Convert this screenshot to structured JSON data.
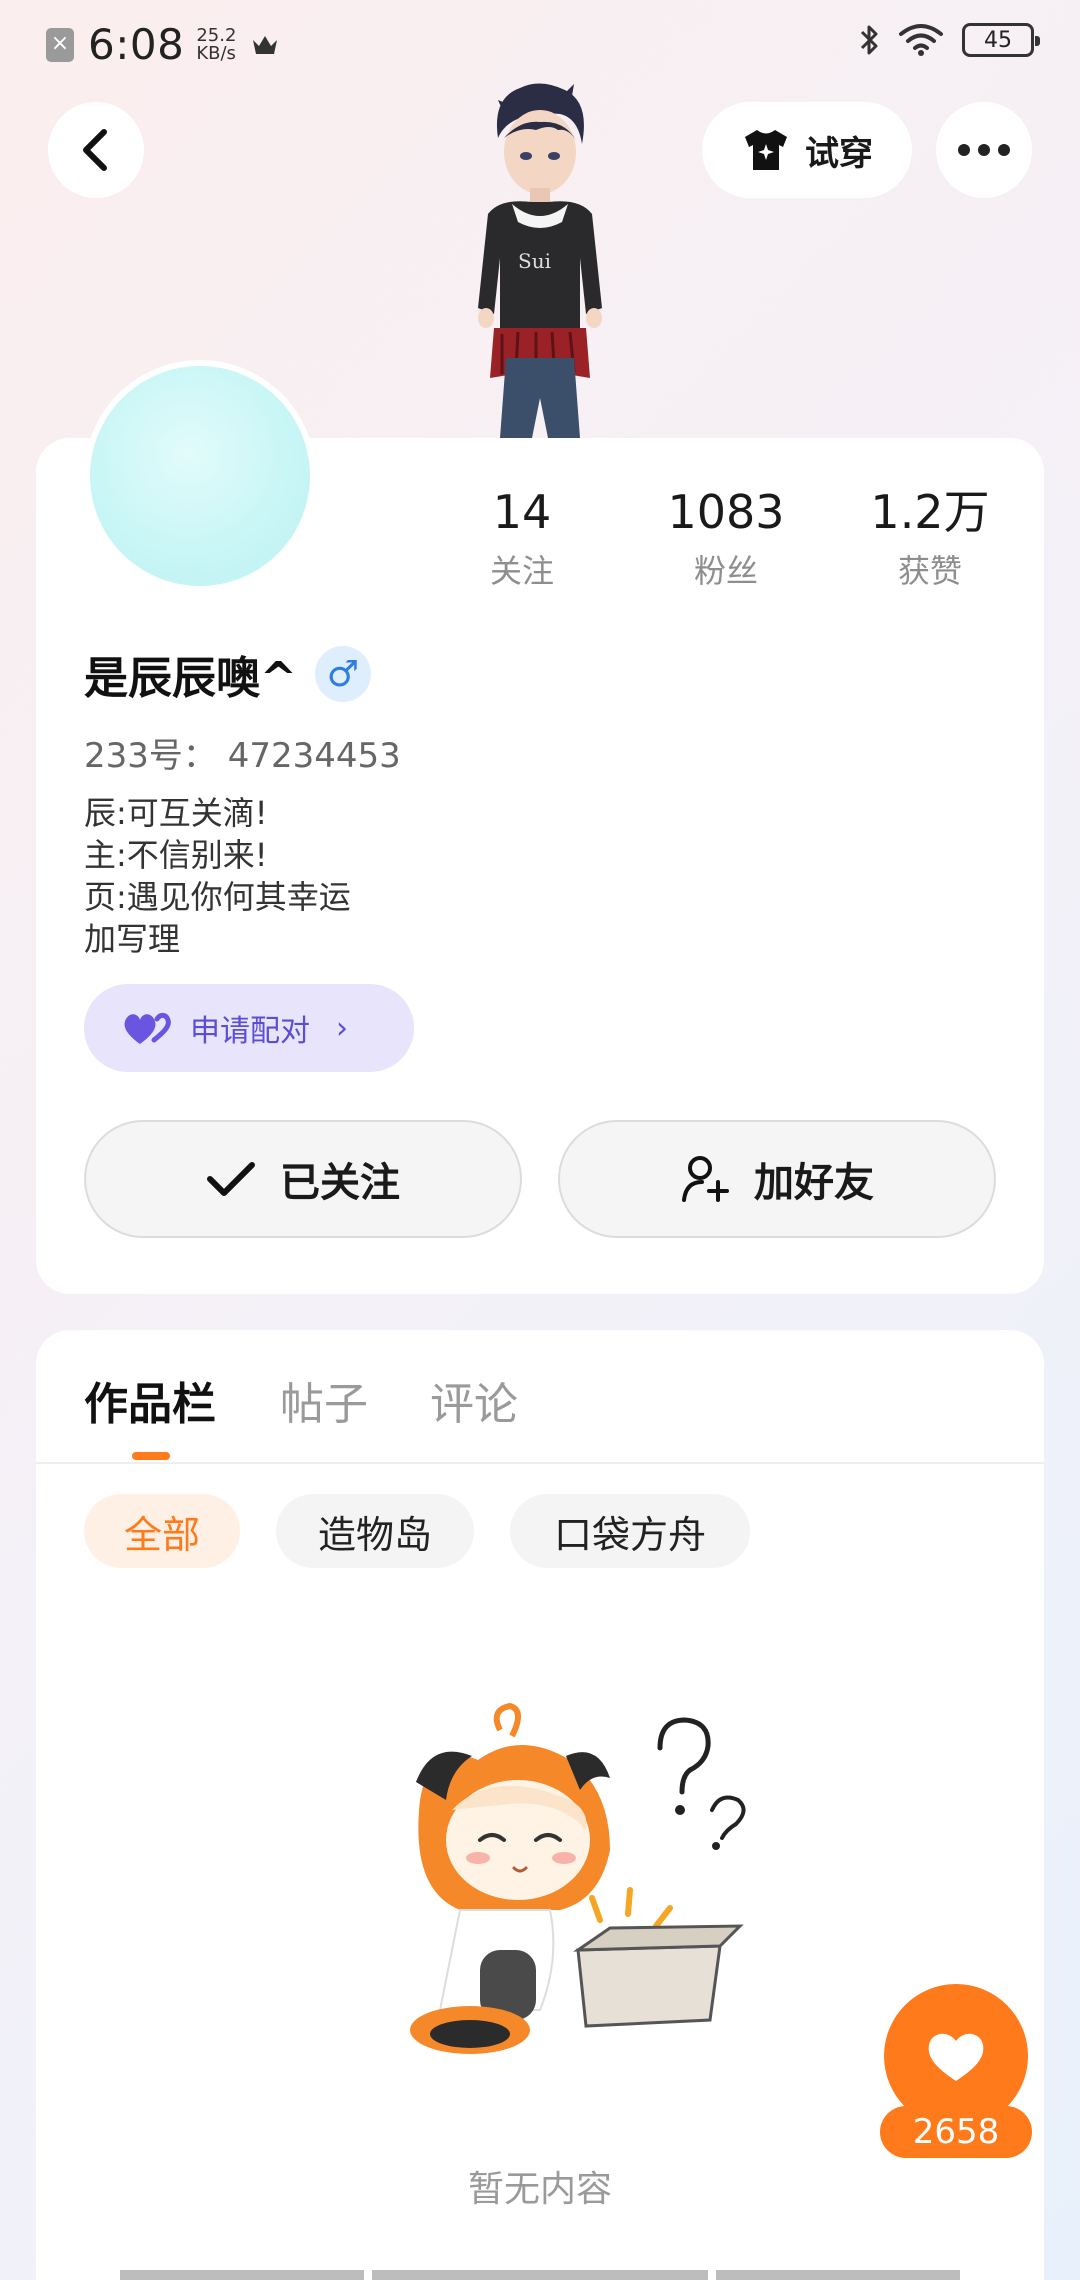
{
  "status_bar": {
    "time": "6:08",
    "speed_value": "25.2",
    "speed_unit": "KB/s",
    "battery": "45"
  },
  "header": {
    "tryon_label": "试穿",
    "icons": [
      "back-icon",
      "tshirt-icon",
      "more-icon"
    ]
  },
  "profile": {
    "stats": [
      {
        "value": "14",
        "label": "关注"
      },
      {
        "value": "1083",
        "label": "粉丝"
      },
      {
        "value": "1.2万",
        "label": "获赞"
      }
    ],
    "nickname": "是辰辰噢^",
    "gender_symbol": "♂",
    "uid": "233号：  47234453",
    "bio": [
      "辰:可互关滴!",
      "主:不信别来!",
      "页:遇见你何其幸运",
      "加写理"
    ],
    "pair_label": "申请配对",
    "follow_label": "已关注",
    "add_friend_label": "加好友",
    "colors": {
      "accent": "#ff7a1a",
      "pair": "#5b4ed4",
      "gender": "#2f7de0"
    }
  },
  "works": {
    "tabs": [
      "作品栏",
      "帖子",
      "评论"
    ],
    "active_tab": 0,
    "chips": [
      "全部",
      "造物岛",
      "口袋方舟"
    ],
    "active_chip": 0,
    "empty_text": "暂无内容"
  },
  "like": {
    "count": "2658"
  }
}
